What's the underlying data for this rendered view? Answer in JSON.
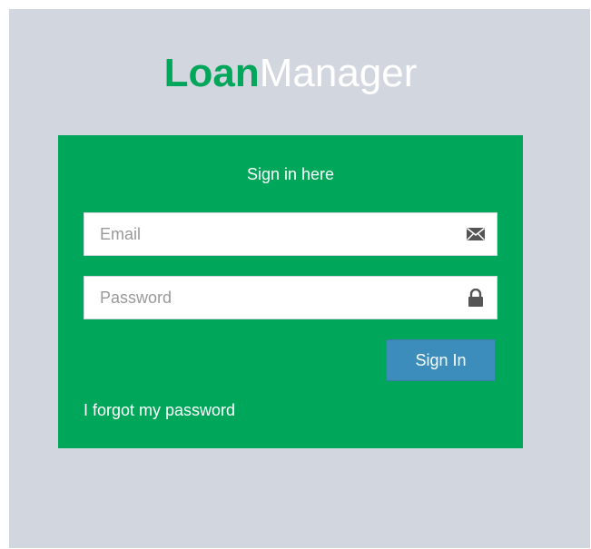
{
  "logo": {
    "bold": "Loan",
    "light": "Manager",
    "bold_color": "#00a65a",
    "light_color": "#ffffff"
  },
  "login": {
    "message": "Sign in here",
    "email": {
      "placeholder": "Email",
      "value": "",
      "icon": "envelope-icon"
    },
    "password": {
      "placeholder": "Password",
      "value": "",
      "icon": "lock-icon"
    },
    "submit_label": "Sign In",
    "forgot_label": "I forgot my password"
  },
  "colors": {
    "page_background": "#d2d6de",
    "box_background": "#00a65a",
    "button_background": "#3c8dbc"
  }
}
